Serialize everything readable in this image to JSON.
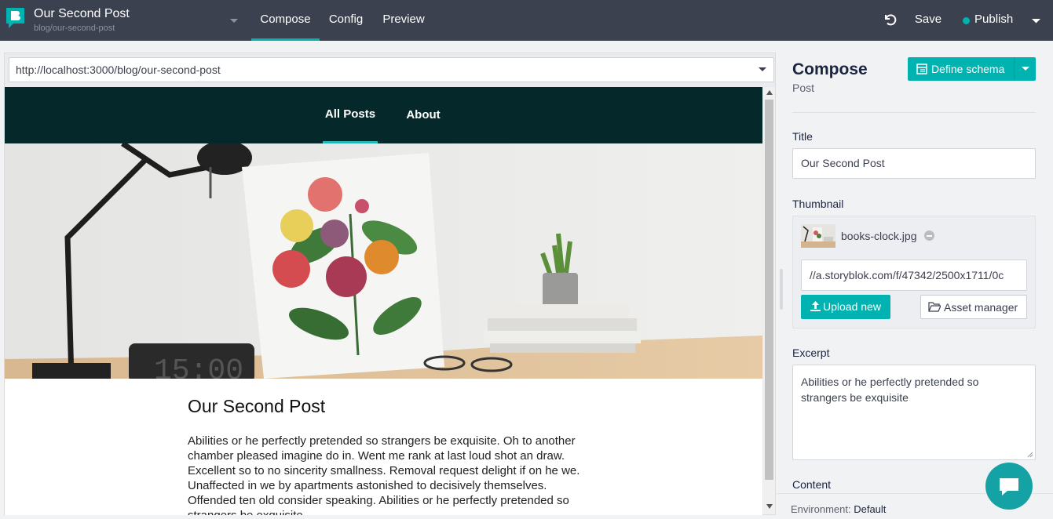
{
  "topbar": {
    "story_title": "Our Second Post",
    "story_slug": "blog/our-second-post",
    "tabs": [
      {
        "label": "Compose",
        "active": true
      },
      {
        "label": "Config",
        "active": false
      },
      {
        "label": "Preview",
        "active": false
      }
    ],
    "save_label": "Save",
    "publish_label": "Publish",
    "status_color": "#00b3b0"
  },
  "preview": {
    "url": "http://localhost:3000/blog/our-second-post",
    "site_nav": [
      "All Posts",
      "About"
    ],
    "post_title": "Our Second Post",
    "post_body": "Abilities or he perfectly pretended so strangers be exquisite. Oh to another chamber pleased imagine do in. Went me rank at last loud shot an draw. Excellent so to no sincerity smallness. Removal request delight if on he we. Unaffected in we by apartments astonished to decisively themselves. Offended ten old consider speaking. Abilities or he perfectly pretended so strangers be exquisite."
  },
  "editor": {
    "title": "Compose",
    "subtitle": "Post",
    "define_schema_label": "Define schema",
    "fields": {
      "title_label": "Title",
      "title_value": "Our Second Post",
      "thumbnail_label": "Thumbnail",
      "asset_name": "books-clock.jpg",
      "asset_url": "//a.storyblok.com/f/47342/2500x1711/0c",
      "upload_label": "Upload new",
      "asset_manager_label": "Asset manager",
      "excerpt_label": "Excerpt",
      "excerpt_value": "Abilities or he perfectly pretended so strangers be exquisite",
      "content_label": "Content"
    },
    "environment_label": "Environment:",
    "environment_value": "Default"
  },
  "colors": {
    "accent": "#00b3b0",
    "topbar_bg": "#3c4150",
    "site_nav_bg": "#05292a"
  },
  "icons": [
    "storyblok-logo-icon",
    "chevron-down-icon",
    "undo-icon",
    "schema-icon",
    "upload-icon",
    "folder-icon",
    "minus-circle-icon",
    "chat-icon"
  ]
}
